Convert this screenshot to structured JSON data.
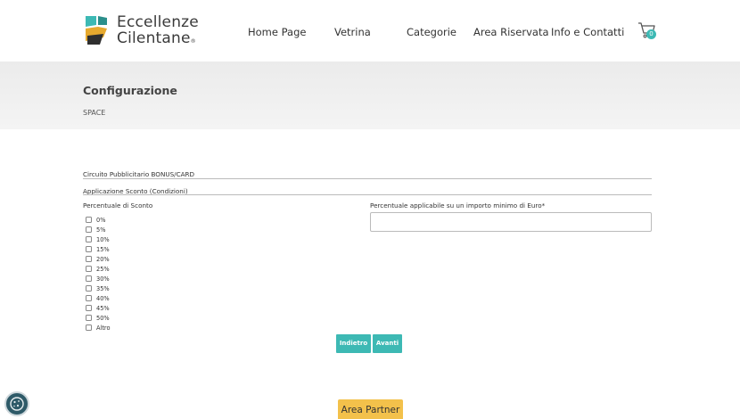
{
  "brand": {
    "line1": "Eccellenze",
    "line2": "Cilentane",
    "registered": "®",
    "colors": {
      "teal": "#3db9b4",
      "gold": "#e6a92e",
      "dark": "#333333"
    }
  },
  "nav": {
    "items": [
      "Home Page",
      "Vetrina",
      "Categorie",
      "Area Riservata",
      "Info e Contatti"
    ]
  },
  "cart": {
    "icon": "cart-icon",
    "count": "0"
  },
  "page": {
    "title": "Configurazione",
    "subtitle": "SPACE"
  },
  "form": {
    "section1": "Circuito Pubblicitario BONUS/CARD",
    "section2": "Applicazione Sconto (Condizioni)",
    "discount_label": "Percentuale di Sconto",
    "discount_options": [
      "0%",
      "5%",
      "10%",
      "15%",
      "20%",
      "25%",
      "30%",
      "35%",
      "40%",
      "45%",
      "50%",
      "Altro"
    ],
    "min_amount_label": "Percentuale applicabile su un importo minimo di Euro*",
    "min_amount_value": ""
  },
  "buttons": {
    "back": "Indietro",
    "next": "Avanti",
    "partner": "Area Partner"
  },
  "cookie": {
    "icon": "cookie-icon"
  }
}
